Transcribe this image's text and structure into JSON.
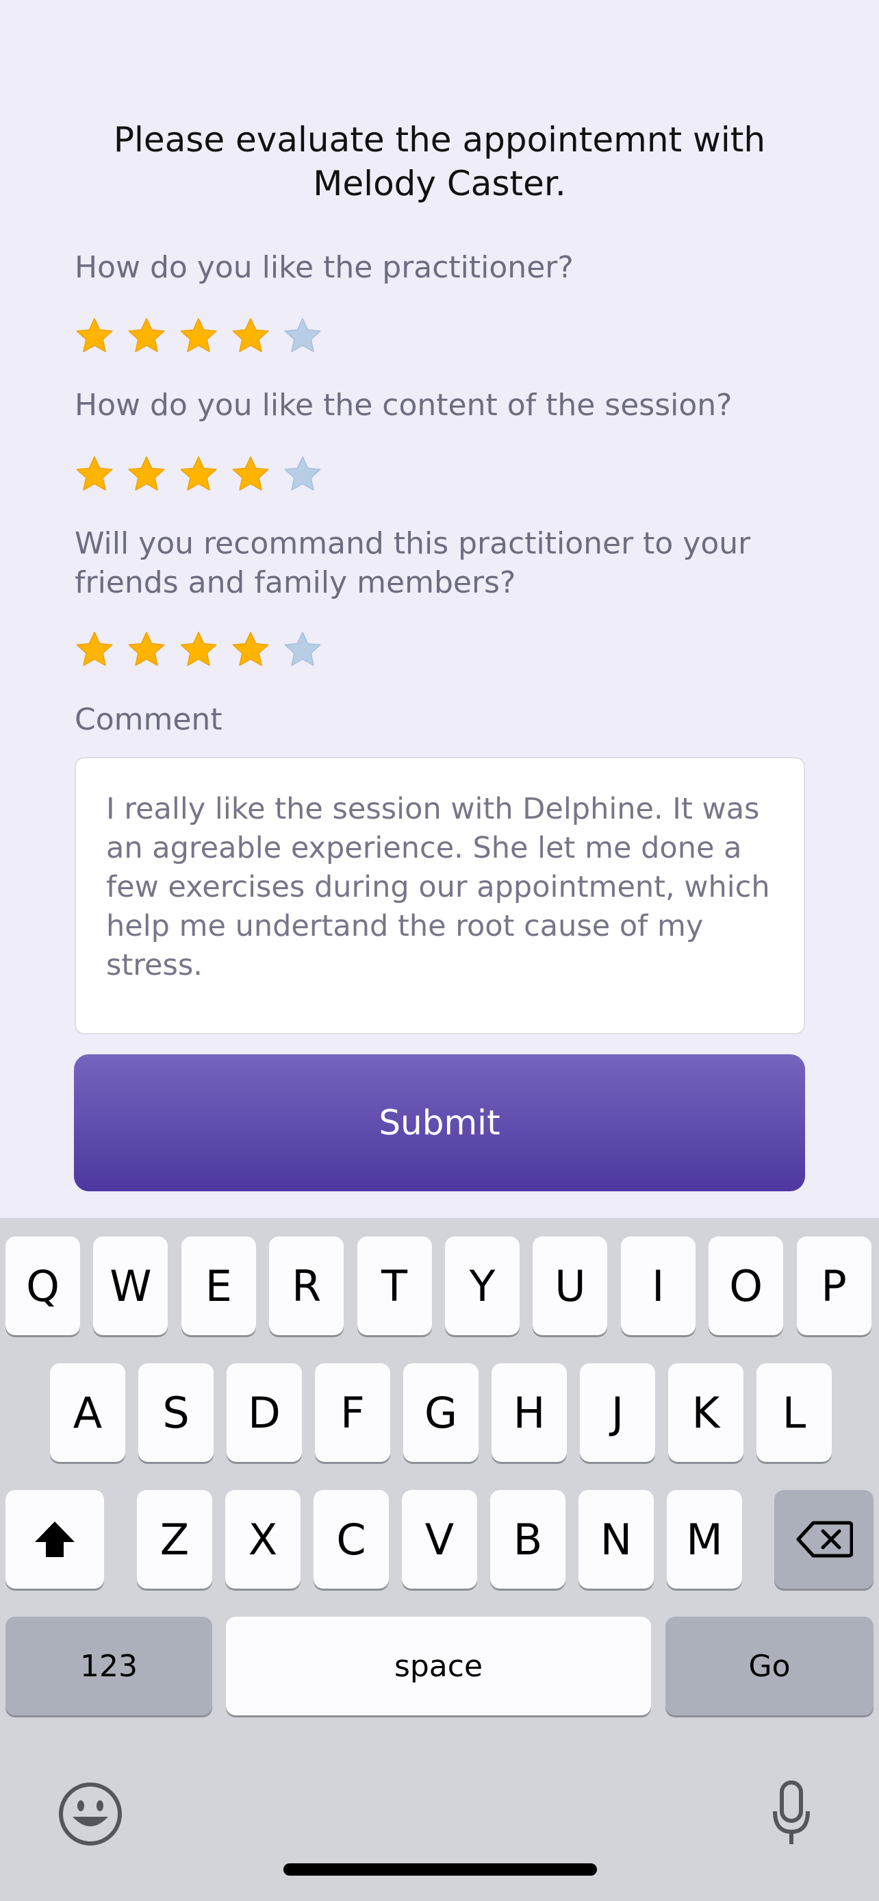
{
  "title": "Please evaluate the appointemnt with Melody Caster.",
  "questions": [
    {
      "label": "How do you like the practitioner?",
      "rating": 4,
      "max": 5
    },
    {
      "label": "How do you like the content of the session?",
      "rating": 4,
      "max": 5
    },
    {
      "label": "Will you recommand this practitioner to your friends and family members?",
      "rating": 4,
      "max": 5
    }
  ],
  "comment": {
    "label": "Comment",
    "value": "I really like the session with Delphine. It was an agreable experience. She let me done a few exercises during our appointment, which help me undertand the root cause of my stress."
  },
  "submit_label": "Submit",
  "keyboard": {
    "row1": [
      "Q",
      "W",
      "E",
      "R",
      "T",
      "Y",
      "U",
      "I",
      "O",
      "P"
    ],
    "row2": [
      "A",
      "S",
      "D",
      "F",
      "G",
      "H",
      "J",
      "K",
      "L"
    ],
    "row3": [
      "Z",
      "X",
      "C",
      "V",
      "B",
      "N",
      "M"
    ],
    "numbers_label": "123",
    "space_label": "space",
    "go_label": "Go",
    "shift_icon": "shift-icon",
    "backspace_icon": "backspace-icon",
    "emoji_icon": "emoji-icon",
    "mic_icon": "microphone-icon"
  },
  "colors": {
    "star_filled": "#ffb400",
    "star_empty": "#b8cde6",
    "accent": "#5b45aa",
    "background": "#eeedf8"
  }
}
